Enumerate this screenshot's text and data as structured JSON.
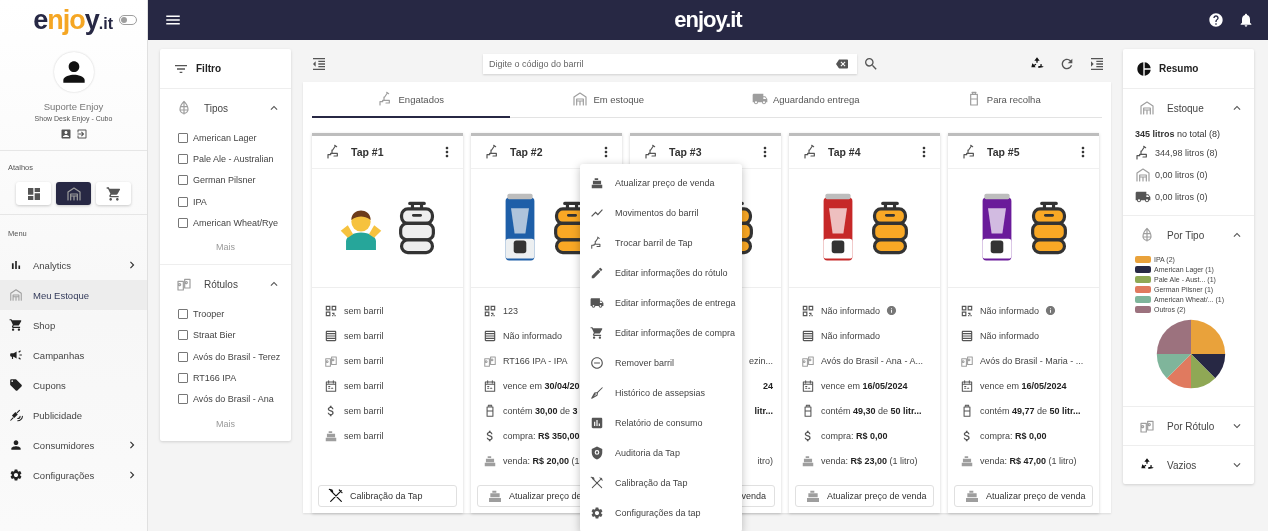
{
  "sidebar": {
    "logo": [
      {
        "text": "e",
        "accent": false
      },
      {
        "text": "njo",
        "accent": true
      },
      {
        "text": "y",
        "accent": false
      },
      {
        "text": ".it",
        "accent": false
      }
    ],
    "theme_toggle": {
      "on": false
    },
    "user": {
      "name": "Suporte Enjoy",
      "subtitle": "Show Desk Enjoy - Cubo"
    },
    "shortcuts_title": "Atalhos",
    "shortcuts": [
      {
        "kind": "dashboard",
        "selected": false
      },
      {
        "kind": "warehouse",
        "selected": true
      },
      {
        "kind": "cart",
        "selected": false
      }
    ],
    "menu_title": "Menu",
    "menu": [
      {
        "kind": "analytics",
        "label": "Analytics",
        "submenu": true,
        "selected": false
      },
      {
        "kind": "warehouse",
        "label": "Meu Estoque",
        "submenu": false,
        "selected": true
      },
      {
        "kind": "cart",
        "label": "Shop",
        "submenu": false,
        "selected": false
      },
      {
        "kind": "campaign",
        "label": "Campanhas",
        "submenu": false,
        "selected": false
      },
      {
        "kind": "tag",
        "label": "Cupons",
        "submenu": false,
        "selected": false
      },
      {
        "kind": "satellite",
        "label": "Publicidade",
        "submenu": false,
        "selected": false
      },
      {
        "kind": "person",
        "label": "Consumidores",
        "submenu": true,
        "selected": false
      },
      {
        "kind": "gear",
        "label": "Configurações",
        "submenu": true,
        "selected": false
      }
    ]
  },
  "topbar": {
    "logo": "enjoy.it"
  },
  "filter": {
    "title": "Filtro",
    "sections": [
      {
        "kind": "types",
        "title": "Tipos",
        "expanded": true,
        "more": "Mais",
        "options": [
          {
            "label": "American Lager",
            "checked": false
          },
          {
            "label": "Pale Ale - Australian",
            "checked": false
          },
          {
            "label": "German Pilsner",
            "checked": false
          },
          {
            "label": "IPA",
            "checked": false
          },
          {
            "label": "American Wheat/Rye",
            "checked": false
          }
        ]
      },
      {
        "kind": "labels",
        "title": "Rótulos",
        "expanded": true,
        "more": "Mais",
        "options": [
          {
            "label": "Trooper",
            "checked": false
          },
          {
            "label": "Straat Bier",
            "checked": false
          },
          {
            "label": "Avós do Brasil - Terez",
            "checked": false
          },
          {
            "label": "RT166 IPA",
            "checked": false
          },
          {
            "label": "Avós do Brasil - Ana",
            "checked": false
          }
        ]
      }
    ]
  },
  "search": {
    "placeholder": "Digite o código do barril"
  },
  "tabs": [
    {
      "kind": "tap",
      "label": "Engatados",
      "selected": true
    },
    {
      "kind": "warehouse",
      "label": "Em estoque",
      "selected": false
    },
    {
      "kind": "truck",
      "label": "Aguardando entrega",
      "selected": false
    },
    {
      "kind": "keg",
      "label": "Para recolha",
      "selected": false
    }
  ],
  "cards": [
    {
      "title": "Tap #1",
      "image": {
        "kind": "figure"
      },
      "keg_filled": false,
      "covered": false,
      "menu_open": false,
      "fields": [
        {
          "kind": "code",
          "text": "sem barril"
        },
        {
          "kind": "batch",
          "text": "sem barril"
        },
        {
          "kind": "label",
          "text": "sem barril"
        },
        {
          "kind": "expiry",
          "text": "sem barril"
        },
        {
          "kind": "purchase",
          "text": "sem barril"
        },
        {
          "kind": "sale",
          "text": "sem barril"
        }
      ],
      "button": {
        "kind": "tools",
        "label": "Calibração da Tap"
      }
    },
    {
      "title": "Tap #2",
      "image": {
        "kind": "picture"
      },
      "keg_filled": true,
      "covered": false,
      "menu_open": true,
      "fields": [
        {
          "kind": "code",
          "text": "123"
        },
        {
          "kind": "batch",
          "text": "Não informado"
        },
        {
          "kind": "label",
          "text": "RT166 IPA - IPA"
        },
        {
          "kind": "expiry",
          "text": "vence em **30/04/20**"
        },
        {
          "kind": "volume",
          "text": "contém **30,00** de **3**"
        },
        {
          "kind": "purchase",
          "text": "compra: **R$ 350,00**"
        },
        {
          "kind": "sale",
          "text": "venda: **R$ 20,00** (1"
        }
      ],
      "button": {
        "kind": "register",
        "label": "Atualizar preço de"
      }
    },
    {
      "title": "Tap #3",
      "keg_filled": true,
      "covered": true,
      "menu_open": false,
      "fields": [
        {
          "kind": "label",
          "text": "ezin..."
        },
        {
          "kind": "expiry",
          "text": "**24**"
        },
        {
          "kind": "volume",
          "text": "**litr...**"
        },
        {
          "kind": "sale",
          "text": "itro)"
        }
      ],
      "button": {
        "label": "venda"
      }
    },
    {
      "title": "Tap #4",
      "image": {
        "kind": "picture"
      },
      "keg_filled": true,
      "covered": false,
      "menu_open": false,
      "fields": [
        {
          "kind": "code",
          "text": "Não informado",
          "info": true
        },
        {
          "kind": "batch",
          "text": "Não informado"
        },
        {
          "kind": "label",
          "text": "Avós do Brasil - Ana - A..."
        },
        {
          "kind": "expiry",
          "text": "vence em **16/05/2024**"
        },
        {
          "kind": "volume",
          "text": "contém **49,30** de **50 litr...**"
        },
        {
          "kind": "purchase",
          "text": "compra: **R$ 0,00**"
        },
        {
          "kind": "sale",
          "text": "venda: **R$ 23,00** (1 litro)"
        }
      ],
      "button": {
        "kind": "register",
        "label": "Atualizar preço de venda"
      }
    },
    {
      "title": "Tap #5",
      "image": {
        "kind": "picture"
      },
      "keg_filled": true,
      "covered": false,
      "menu_open": false,
      "fields": [
        {
          "kind": "code",
          "text": "Não informado",
          "info": true
        },
        {
          "kind": "batch",
          "text": "Não informado"
        },
        {
          "kind": "label",
          "text": "Avós do Brasil - Maria - ..."
        },
        {
          "kind": "expiry",
          "text": "vence em **16/05/2024**"
        },
        {
          "kind": "volume",
          "text": "contém **49,77** de **50 litr...**"
        },
        {
          "kind": "purchase",
          "text": "compra: **R$ 0,00**"
        },
        {
          "kind": "sale",
          "text": "venda: **R$ 47,00** (1 litro)"
        }
      ],
      "button": {
        "kind": "register",
        "label": "Atualizar preço de venda"
      }
    }
  ],
  "card_menu": [
    {
      "kind": "register",
      "label": "Atualizar preço de venda"
    },
    {
      "kind": "chart",
      "label": "Movimentos do barril"
    },
    {
      "kind": "tap",
      "label": "Trocar barril de Tap"
    },
    {
      "kind": "edit",
      "label": "Editar informações do rótulo"
    },
    {
      "kind": "truck",
      "label": "Editar informações de entrega"
    },
    {
      "kind": "cart",
      "label": "Editar informações de compra"
    },
    {
      "kind": "remove",
      "label": "Remover barril"
    },
    {
      "kind": "broom",
      "label": "Histórico de assepsias"
    },
    {
      "kind": "report",
      "label": "Relatório de consumo"
    },
    {
      "kind": "shield",
      "label": "Auditoria da Tap"
    },
    {
      "kind": "tools",
      "label": "Calibração da Tap"
    },
    {
      "kind": "gear",
      "label": "Configurações da tap"
    }
  ],
  "summary": {
    "title": "Resumo",
    "sections": [
      {
        "kind": "stock",
        "title": "Estoque",
        "expanded": true,
        "total": "**345 litros** no total (8)",
        "rows": [
          {
            "kind": "tap",
            "text": "344,98 litros (8)"
          },
          {
            "kind": "warehouse",
            "text": "0,00 litros (0)"
          },
          {
            "kind": "truck",
            "text": "0,00 litros (0)"
          }
        ]
      },
      {
        "kind": "types",
        "title": "Por Tipo",
        "expanded": true,
        "legend": [
          {
            "label": "IPA (2)",
            "color": "#e9a23b"
          },
          {
            "label": "American Lager (1)",
            "color": "#272844"
          },
          {
            "label": "Pale Ale - Aust... (1)",
            "color": "#8fa855"
          },
          {
            "label": "German Pilsner (1)",
            "color": "#e07a5f"
          },
          {
            "label": "American Wheat/... (1)",
            "color": "#7fb59b"
          },
          {
            "label": "Outros (2)",
            "color": "#9c727e"
          }
        ],
        "chart_data": {
          "type": "pie",
          "values": [
            25,
            12.5,
            12.5,
            12.5,
            12.5,
            25
          ]
        }
      },
      {
        "kind": "labels",
        "title": "Por Rótulo",
        "expanded": false
      },
      {
        "kind": "empty",
        "title": "Vazios",
        "expanded": false
      }
    ]
  }
}
